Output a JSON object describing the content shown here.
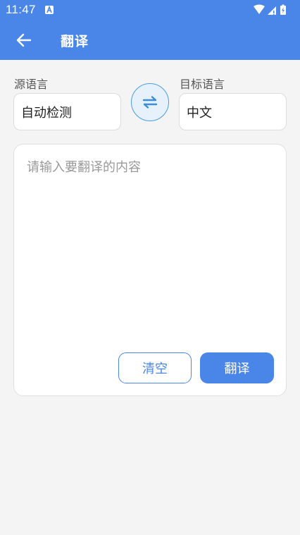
{
  "status_bar": {
    "time": "11:47",
    "icons": [
      "notification-a-icon",
      "wifi-icon",
      "signal-icon",
      "battery-charging-icon"
    ]
  },
  "toolbar": {
    "back_icon": "arrow-left-icon",
    "title": "翻译",
    "color": "#4a86e8"
  },
  "source_language": {
    "label": "源语言",
    "value": "自动检测"
  },
  "swap": {
    "icon": "swap-arrows-icon"
  },
  "target_language": {
    "label": "目标语言",
    "value": "中文"
  },
  "input": {
    "placeholder": "请输入要翻译的内容",
    "value": ""
  },
  "actions": {
    "clear_label": "清空",
    "translate_label": "翻译"
  }
}
